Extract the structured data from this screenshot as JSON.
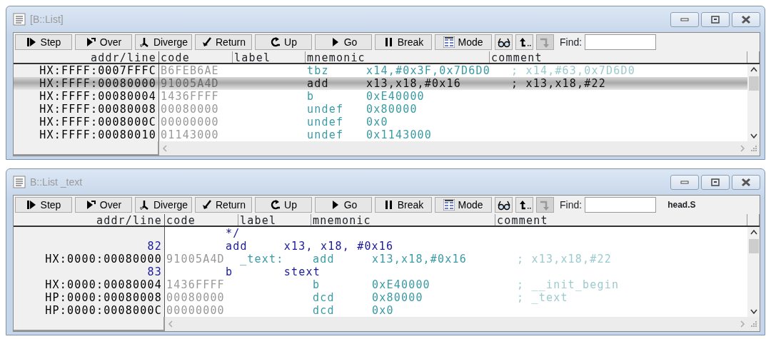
{
  "windows": [
    {
      "title": "[B::List]",
      "toolbar": {
        "buttons": [
          "Step",
          "Over",
          "Diverge",
          "Return",
          "Up",
          "Go",
          "Break",
          "Mode"
        ],
        "tools": [
          {
            "disabled": false
          },
          {
            "disabled": false
          },
          {
            "disabled": true
          }
        ],
        "find_label": "Find:"
      },
      "columns": [
        "addr/line",
        "code",
        "label",
        "mnemonic",
        "comment"
      ],
      "rows": [
        {
          "kind": "asm",
          "selected": false,
          "addr": "HX:FFFF:0007FFFC",
          "code": "B6FEB6AE",
          "mnemonic": "tbz",
          "operands": "x14,#0x3F,0x7D6D0",
          "comment": "; x14,#63,0x7D6D0"
        },
        {
          "kind": "asm",
          "selected": true,
          "addr": "HX:FFFF:00080000",
          "code": "91005A4D",
          "mnemonic": "add",
          "operands": "x13,x18,#0x16",
          "comment": "; x13,x18,#22"
        },
        {
          "kind": "asm",
          "selected": false,
          "addr": "HX:FFFF:00080004",
          "code": "1436FFFF",
          "mnemonic": "b",
          "operands": "0xE40000"
        },
        {
          "kind": "asm",
          "selected": false,
          "addr": "HX:FFFF:00080008",
          "code": "00080000",
          "mnemonic": "undef",
          "operands": "0x80000"
        },
        {
          "kind": "asm",
          "selected": false,
          "addr": "HX:FFFF:0008000C",
          "code": "00000000",
          "mnemonic": "undef",
          "operands": "0x0"
        },
        {
          "kind": "asm",
          "selected": false,
          "addr": "HX:FFFF:00080010",
          "code": "01143000",
          "mnemonic": "undef",
          "operands": "0x1143000"
        }
      ]
    },
    {
      "title": "B::List _text",
      "toolbar": {
        "buttons": [
          "Step",
          "Over",
          "Diverge",
          "Return",
          "Up",
          "Go",
          "Break",
          "Mode"
        ],
        "tools": [
          {
            "disabled": false
          },
          {
            "disabled": false
          },
          {
            "disabled": true
          }
        ],
        "find_label": "Find:",
        "file": "head.S"
      },
      "columns": [
        "addr/line",
        "code",
        "label",
        "mnemonic",
        "comment"
      ],
      "rows": [
        {
          "kind": "source",
          "text": "*/"
        },
        {
          "kind": "source",
          "line": "82",
          "text": "add     x13, x18, #0x16"
        },
        {
          "kind": "asm",
          "selected": false,
          "addr": "HX:0000:00080000",
          "code": "91005A4D",
          "label": "_text:",
          "mnemonic": "add",
          "operands": "x13,x18,#0x16",
          "comment": "; x13,x18,#22"
        },
        {
          "kind": "source",
          "line": "83",
          "text": "b       stext"
        },
        {
          "kind": "asm",
          "selected": false,
          "addr": "HX:0000:00080004",
          "code": "1436FFFF",
          "mnemonic": "b",
          "operands": "0xE40000",
          "comment": "; __init_begin"
        },
        {
          "kind": "asm",
          "selected": false,
          "addr": "HP:0000:00080008",
          "code": "00080000",
          "mnemonic": "dcd",
          "operands": "0x80000",
          "comment": "; _text"
        },
        {
          "kind": "asm",
          "selected": false,
          "addr": "HP:0000:0008000C",
          "code": "00000000",
          "mnemonic": "dcd",
          "operands": "0x0"
        }
      ]
    }
  ]
}
